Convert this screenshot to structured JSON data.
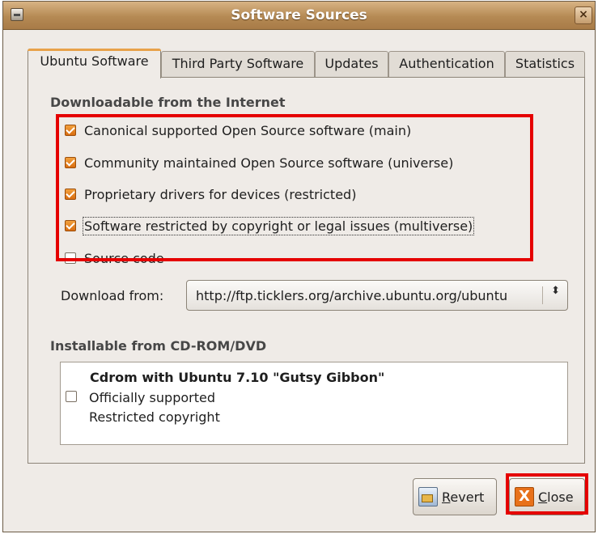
{
  "window": {
    "title": "Software Sources",
    "close_glyph": "×"
  },
  "tabs": [
    "Ubuntu Software",
    "Third Party Software",
    "Updates",
    "Authentication",
    "Statistics"
  ],
  "internet": {
    "heading": "Downloadable from the Internet",
    "items": [
      {
        "label": "Canonical supported Open Source software (main)",
        "checked": true
      },
      {
        "label": "Community maintained Open Source software (universe)",
        "checked": true
      },
      {
        "label": "Proprietary drivers for devices (restricted)",
        "checked": true
      },
      {
        "label": "Software restricted by copyright or legal issues (multiverse)",
        "checked": true
      },
      {
        "label": "Source code",
        "checked": false
      }
    ],
    "download_label": "Download from:",
    "download_value": "http://ftp.ticklers.org/archive.ubuntu.org/ubuntu",
    "combo_arrow": "⬍"
  },
  "cdrom": {
    "heading": "Installable from CD-ROM/DVD",
    "title": "Cdrom with Ubuntu 7.10 \"Gutsy Gibbon\"",
    "line1": "Officially supported",
    "line2": "Restricted copyright",
    "checked": false
  },
  "buttons": {
    "revert_mnemonic": "R",
    "revert_rest": "evert",
    "close_mnemonic": "C",
    "close_rest": "lose",
    "close_icon_glyph": "X"
  },
  "colors": {
    "highlight": "#e50000",
    "accent": "#e8711a"
  }
}
